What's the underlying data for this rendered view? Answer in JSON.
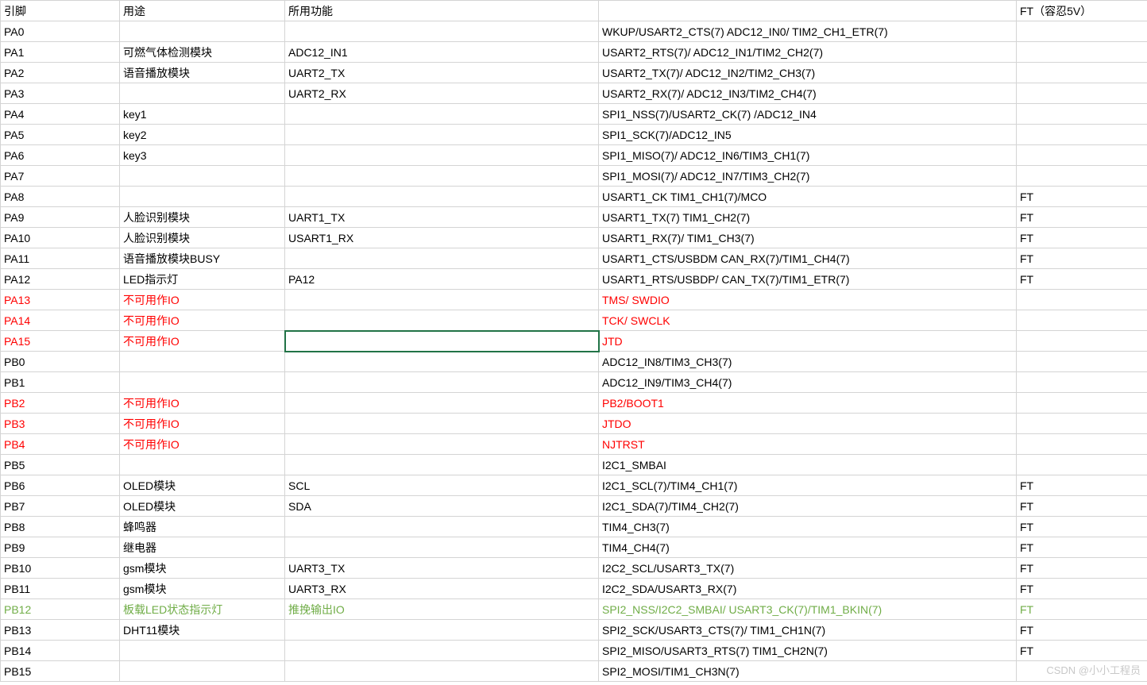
{
  "headers": [
    "引脚",
    "用途",
    "所用功能",
    "",
    "FT（容忍5V）"
  ],
  "rows": [
    {
      "cells": [
        "PA0",
        "",
        "",
        "WKUP/USART2_CTS(7) ADC12_IN0/ TIM2_CH1_ETR(7)",
        ""
      ],
      "cls": ""
    },
    {
      "cells": [
        "PA1",
        "可燃气体检测模块",
        "ADC12_IN1",
        "USART2_RTS(7)/ ADC12_IN1/TIM2_CH2(7)",
        ""
      ],
      "cls": ""
    },
    {
      "cells": [
        "PA2",
        "语音播放模块",
        "UART2_TX",
        "USART2_TX(7)/ ADC12_IN2/TIM2_CH3(7)",
        ""
      ],
      "cls": ""
    },
    {
      "cells": [
        "PA3",
        "",
        "UART2_RX",
        "USART2_RX(7)/ ADC12_IN3/TIM2_CH4(7)",
        ""
      ],
      "cls": ""
    },
    {
      "cells": [
        "PA4",
        "key1",
        "",
        "SPI1_NSS(7)/USART2_CK(7) /ADC12_IN4",
        ""
      ],
      "cls": ""
    },
    {
      "cells": [
        "PA5",
        "key2",
        "",
        "SPI1_SCK(7)/ADC12_IN5",
        ""
      ],
      "cls": ""
    },
    {
      "cells": [
        "PA6",
        "key3",
        "",
        "SPI1_MISO(7)/ ADC12_IN6/TIM3_CH1(7)",
        ""
      ],
      "cls": ""
    },
    {
      "cells": [
        "PA7",
        "",
        "",
        "SPI1_MOSI(7)/ ADC12_IN7/TIM3_CH2(7)",
        ""
      ],
      "cls": ""
    },
    {
      "cells": [
        "PA8",
        "",
        "",
        "USART1_CK TIM1_CH1(7)/MCO",
        "FT"
      ],
      "cls": ""
    },
    {
      "cells": [
        "PA9",
        "人脸识别模块",
        "UART1_TX",
        "USART1_TX(7) TIM1_CH2(7)",
        "FT"
      ],
      "cls": ""
    },
    {
      "cells": [
        "PA10",
        "人脸识别模块",
        "USART1_RX",
        "USART1_RX(7)/ TIM1_CH3(7)",
        "FT"
      ],
      "cls": ""
    },
    {
      "cells": [
        "PA11",
        "语音播放模块BUSY",
        "",
        "USART1_CTS/USBDM CAN_RX(7)/TIM1_CH4(7)",
        "FT"
      ],
      "cls": ""
    },
    {
      "cells": [
        "PA12",
        "LED指示灯",
        "PA12",
        "USART1_RTS/USBDP/ CAN_TX(7)/TIM1_ETR(7)",
        "FT"
      ],
      "cls": ""
    },
    {
      "cells": [
        "PA13",
        "不可用作IO",
        "",
        "TMS/ SWDIO",
        ""
      ],
      "cls": "red"
    },
    {
      "cells": [
        "PA14",
        "不可用作IO",
        "",
        "TCK/ SWCLK",
        ""
      ],
      "cls": "red"
    },
    {
      "cells": [
        "PA15",
        "不可用作IO",
        "",
        "JTD",
        ""
      ],
      "cls": "red",
      "selected": 2
    },
    {
      "cells": [
        "PB0",
        "",
        "",
        "ADC12_IN8/TIM3_CH3(7)",
        ""
      ],
      "cls": ""
    },
    {
      "cells": [
        "PB1",
        "",
        "",
        "ADC12_IN9/TIM3_CH4(7)",
        ""
      ],
      "cls": ""
    },
    {
      "cells": [
        "PB2",
        "不可用作IO",
        "",
        "PB2/BOOT1",
        ""
      ],
      "cls": "red"
    },
    {
      "cells": [
        "PB3",
        "不可用作IO",
        "",
        "JTDO",
        ""
      ],
      "cls": "red"
    },
    {
      "cells": [
        "PB4",
        "不可用作IO",
        "",
        "NJTRST",
        ""
      ],
      "cls": "red"
    },
    {
      "cells": [
        "PB5",
        "",
        "",
        "I2C1_SMBAI",
        ""
      ],
      "cls": ""
    },
    {
      "cells": [
        "PB6",
        "OLED模块",
        "SCL",
        "I2C1_SCL(7)/TIM4_CH1(7)",
        "FT"
      ],
      "cls": ""
    },
    {
      "cells": [
        "PB7",
        "OLED模块",
        "SDA",
        "I2C1_SDA(7)/TIM4_CH2(7)",
        "FT"
      ],
      "cls": ""
    },
    {
      "cells": [
        "PB8",
        "蜂鸣器",
        "",
        "TIM4_CH3(7)",
        "FT"
      ],
      "cls": ""
    },
    {
      "cells": [
        "PB9",
        "继电器",
        "",
        "TIM4_CH4(7)",
        "FT"
      ],
      "cls": ""
    },
    {
      "cells": [
        "PB10",
        "gsm模块",
        "UART3_TX",
        "I2C2_SCL/USART3_TX(7)",
        "FT"
      ],
      "cls": ""
    },
    {
      "cells": [
        "PB11",
        "gsm模块",
        "UART3_RX",
        "I2C2_SDA/USART3_RX(7)",
        "FT"
      ],
      "cls": ""
    },
    {
      "cells": [
        "PB12",
        "板载LED状态指示灯",
        "推挽输出IO",
        "SPI2_NSS/I2C2_SMBAI/ USART3_CK(7)/TIM1_BKIN(7)",
        "FT"
      ],
      "cls": "green"
    },
    {
      "cells": [
        "PB13",
        "DHT11模块",
        "",
        "SPI2_SCK/USART3_CTS(7)/ TIM1_CH1N(7)",
        "FT"
      ],
      "cls": ""
    },
    {
      "cells": [
        "PB14",
        "",
        "",
        "SPI2_MISO/USART3_RTS(7) TIM1_CH2N(7)",
        "FT"
      ],
      "cls": ""
    },
    {
      "cells": [
        "PB15",
        "",
        "",
        "SPI2_MOSI/TIM1_CH3N(7)",
        ""
      ],
      "cls": ""
    }
  ],
  "watermark": "CSDN @小小工程员"
}
